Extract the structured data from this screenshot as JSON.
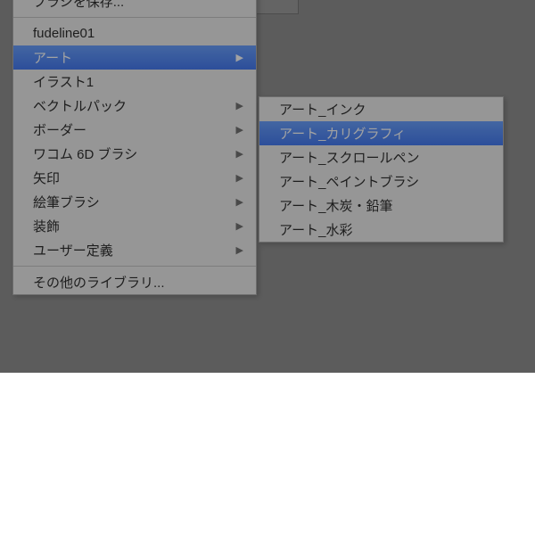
{
  "mainMenu": {
    "group1": [
      {
        "label": "ブラシを保存...",
        "hasSub": false
      }
    ],
    "group2": [
      {
        "label": "fudeline01",
        "hasSub": false
      },
      {
        "label": "アート",
        "hasSub": true,
        "highlight": true
      },
      {
        "label": "イラスト1",
        "hasSub": false
      },
      {
        "label": "ベクトルパック",
        "hasSub": true
      },
      {
        "label": "ボーダー",
        "hasSub": true
      },
      {
        "label": "ワコム 6D ブラシ",
        "hasSub": true
      },
      {
        "label": "矢印",
        "hasSub": true
      },
      {
        "label": "絵筆ブラシ",
        "hasSub": true
      },
      {
        "label": "装飾",
        "hasSub": true
      },
      {
        "label": "ユーザー定義",
        "hasSub": true
      }
    ],
    "group3": [
      {
        "label": "その他のライブラリ...",
        "hasSub": false
      }
    ]
  },
  "subMenu": [
    {
      "label": "アート_インク",
      "highlight": false
    },
    {
      "label": "アート_カリグラフィ",
      "highlight": true
    },
    {
      "label": "アート_スクロールペン",
      "highlight": false
    },
    {
      "label": "アート_ペイントブラシ",
      "highlight": false
    },
    {
      "label": "アート_木炭・鉛筆",
      "highlight": false
    },
    {
      "label": "アート_水彩",
      "highlight": false
    }
  ]
}
